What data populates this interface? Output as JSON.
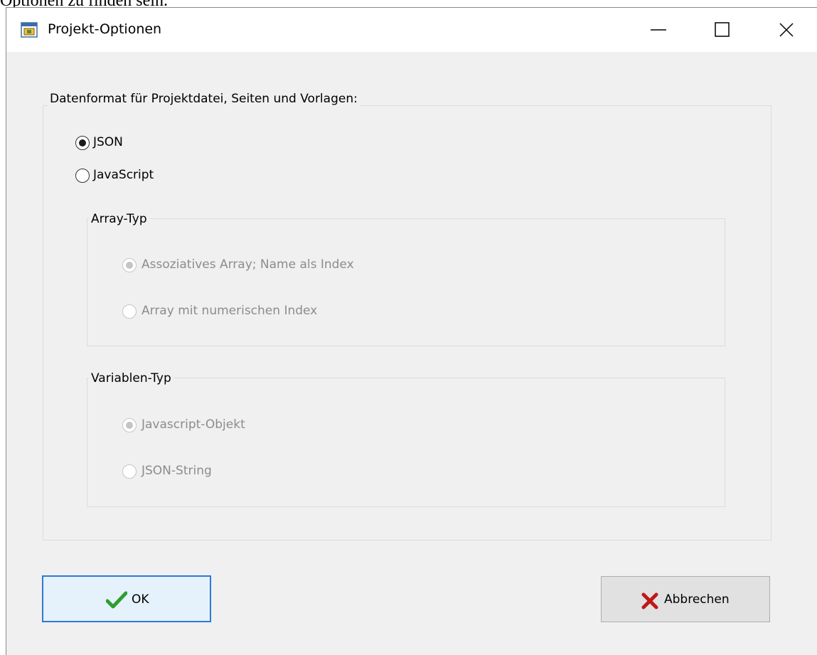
{
  "background_text": "Optionen zu finden sein.",
  "window": {
    "title": "Projekt-Optionen",
    "controls": {
      "minimize": "minimize",
      "maximize": "maximize",
      "close": "close"
    }
  },
  "data_format": {
    "label": "Datenformat für Projektdatei, Seiten und Vorlagen:",
    "options": [
      {
        "label": "JSON",
        "selected": true,
        "enabled": true
      },
      {
        "label": "JavaScript",
        "selected": false,
        "enabled": true
      }
    ]
  },
  "array_type": {
    "label": "Array-Typ",
    "options": [
      {
        "label": "Assoziatives Array; Name als Index",
        "selected": true,
        "enabled": false
      },
      {
        "label": "Array mit numerischen Index",
        "selected": false,
        "enabled": false
      }
    ]
  },
  "variable_type": {
    "label": "Variablen-Typ",
    "options": [
      {
        "label": "Javascript-Objekt",
        "selected": true,
        "enabled": false
      },
      {
        "label": "JSON-String",
        "selected": false,
        "enabled": false
      }
    ]
  },
  "buttons": {
    "ok": "OK",
    "cancel": "Abbrechen"
  },
  "colors": {
    "ok_check": "#2e9e2e",
    "cancel_x": "#c01818",
    "default_border": "#2b7ad6"
  }
}
